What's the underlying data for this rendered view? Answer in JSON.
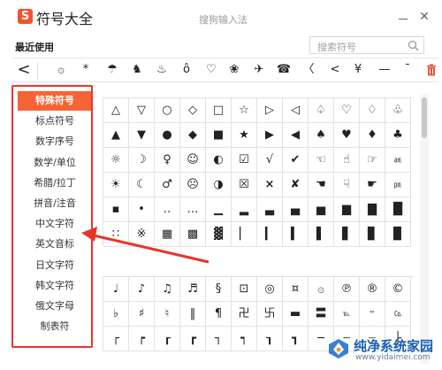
{
  "window": {
    "logo_letter": "S",
    "title": "符号大全",
    "ime_title": "搜狗输入法",
    "minimize": "—",
    "close": "✕"
  },
  "recent": {
    "label": "最近使用",
    "search_placeholder": "搜索符号",
    "symbols": [
      "〈",
      "۞",
      "*",
      "☂",
      "♞",
      "♨",
      "ô",
      "♡",
      "❀",
      "✈",
      "☎",
      "〈",
      "<",
      "¥",
      "—",
      "¯"
    ],
    "first_symbol": "<"
  },
  "categories": [
    {
      "label": "特殊符号",
      "active": true
    },
    {
      "label": "标点符号",
      "active": false
    },
    {
      "label": "数字序号",
      "active": false
    },
    {
      "label": "数学/单位",
      "active": false
    },
    {
      "label": "希腊/拉丁",
      "active": false
    },
    {
      "label": "拼音/注音",
      "active": false
    },
    {
      "label": "中文字符",
      "active": false
    },
    {
      "label": "英文音标",
      "active": false
    },
    {
      "label": "日文字符",
      "active": false
    },
    {
      "label": "韩文字符",
      "active": false
    },
    {
      "label": "俄文字母",
      "active": false
    },
    {
      "label": "制表符",
      "active": false
    }
  ],
  "symbols_top": [
    [
      "△",
      "▽",
      "○",
      "◇",
      "□",
      "☆",
      "▷",
      "◁",
      "♤",
      "♡",
      "♢",
      "♧"
    ],
    [
      "▲",
      "▼",
      "●",
      "◆",
      "■",
      "★",
      "▶",
      "◀",
      "♠",
      "♥",
      "♦",
      "♣"
    ],
    [
      "☼",
      "☽",
      "♀",
      "☺",
      "◐",
      "☑",
      "√",
      "✔",
      "☜",
      "☝",
      "☞",
      "㏂"
    ],
    [
      "☀",
      "☾",
      "♂",
      "☹",
      "◑",
      "☒",
      "×",
      "✘",
      "☚",
      "☟",
      "☛",
      "㏘"
    ],
    [
      "▪",
      "•",
      "‥",
      "…",
      "▁",
      "▂",
      "▃",
      "▄",
      "▅",
      "▆",
      "▇",
      "█"
    ],
    [
      "∷",
      "※",
      "▦",
      "▩",
      "▓",
      "▏",
      "▎",
      "▍",
      "▌",
      "▋",
      "▊",
      "▉"
    ]
  ],
  "symbols_bottom": [
    [
      "♩",
      "♪",
      "♫",
      "♬",
      "§",
      "⊡",
      "◎",
      "¤",
      "۞",
      "℗",
      "®",
      "©"
    ],
    [
      "♭",
      "♯",
      "♮",
      "‖",
      "¶",
      "卍",
      "卐",
      "▬",
      "〓",
      "℡",
      "™",
      "㏇"
    ],
    [
      "┌",
      "┍",
      "┎",
      "┏",
      "┐",
      "┑",
      "┒",
      "┓",
      "─",
      "┄",
      "┈",
      "├"
    ]
  ],
  "watermark": {
    "text": "纯净系统家园",
    "url": "www.yidaimei.com"
  }
}
